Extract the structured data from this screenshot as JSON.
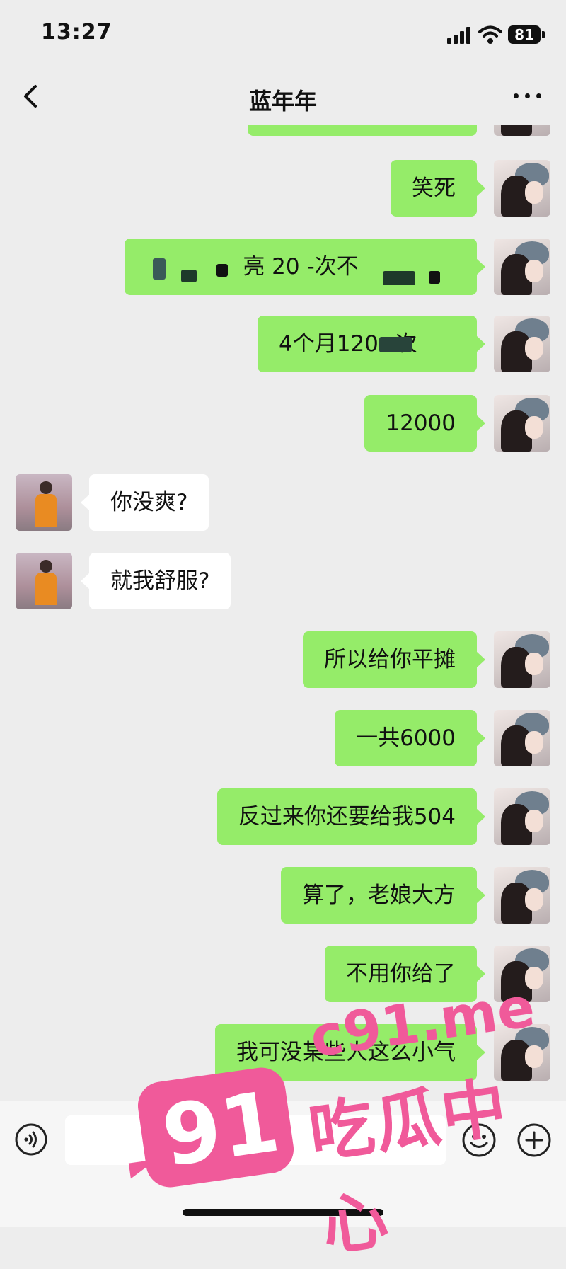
{
  "status_bar": {
    "time": "13:27",
    "battery": "81"
  },
  "nav": {
    "title": "蓝年年"
  },
  "messages": [
    {
      "side": "right",
      "text": "笑死"
    },
    {
      "side": "right",
      "text": "亮 20 -次不"
    },
    {
      "side": "right",
      "text": "4个月120 次"
    },
    {
      "side": "right",
      "text": "12000"
    },
    {
      "side": "left",
      "text": "你没爽?"
    },
    {
      "side": "left",
      "text": "就我舒服?"
    },
    {
      "side": "right",
      "text": "所以给你平摊"
    },
    {
      "side": "right",
      "text": "一共6000"
    },
    {
      "side": "right",
      "text": "反过来你还要给我504"
    },
    {
      "side": "right",
      "text": "算了，老娘大方"
    },
    {
      "side": "right",
      "text": "不用你给了"
    },
    {
      "side": "right",
      "text": "我可没某些人这么小气"
    }
  ],
  "watermark": {
    "number": "91",
    "url": "c91.me",
    "label": "吃瓜中心"
  }
}
